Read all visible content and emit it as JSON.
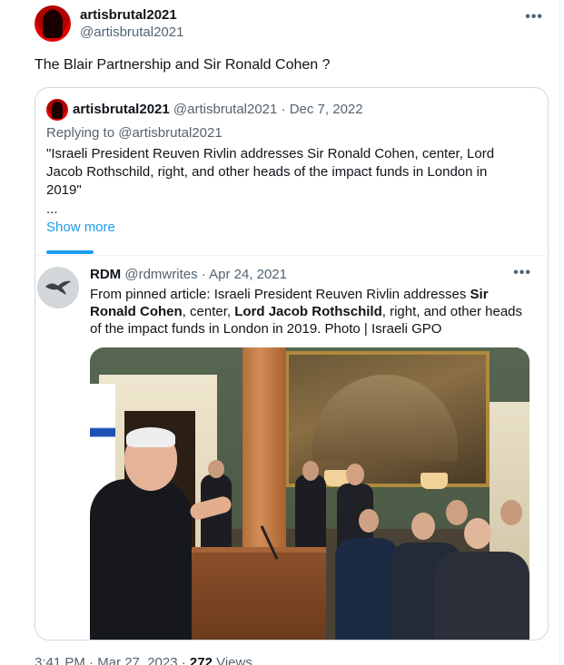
{
  "tweet": {
    "display_name": "artisbrutal2021",
    "handle": "@artisbrutal2021",
    "more_icon": "more-horizontal-icon",
    "text": "The Blair Partnership and Sir Ronald Cohen ?",
    "timestamp": "3:41 PM · Mar 27, 2023 · ",
    "views_count": "272",
    "views_label": " Views"
  },
  "quote": {
    "display_name": "artisbrutal2021",
    "handle": "@artisbrutal2021",
    "separator": "·",
    "date": "Dec 7, 2022",
    "replying_prefix": "Replying to ",
    "replying_mention": "@artisbrutal2021",
    "body": "\"Israeli President Reuven Rivlin addresses Sir Ronald Cohen, center, Lord Jacob Rothschild, right, and other heads of the impact funds in London in 2019\"",
    "ellipsis": "...",
    "show_more": "Show more"
  },
  "nested": {
    "display_name": "RDM",
    "handle": "@rdmwrites",
    "separator": "·",
    "date": "Apr 24, 2021",
    "body_1": "From pinned article: Israeli President Reuven Rivlin addresses ",
    "body_bold_1": "Sir Ronald Cohen",
    "body_2": ", center, ",
    "body_bold_2": "Lord Jacob Rothschild",
    "body_3": ", right, and other heads of the impact funds in London in 2019. Photo | Israeli GPO",
    "avatar_icon": "bird-icon",
    "more_icon": "more-horizontal-icon"
  },
  "colors": {
    "accent": "#1d9bf0",
    "muted": "#536471",
    "text": "#0f1419",
    "border": "#cfd9de"
  }
}
